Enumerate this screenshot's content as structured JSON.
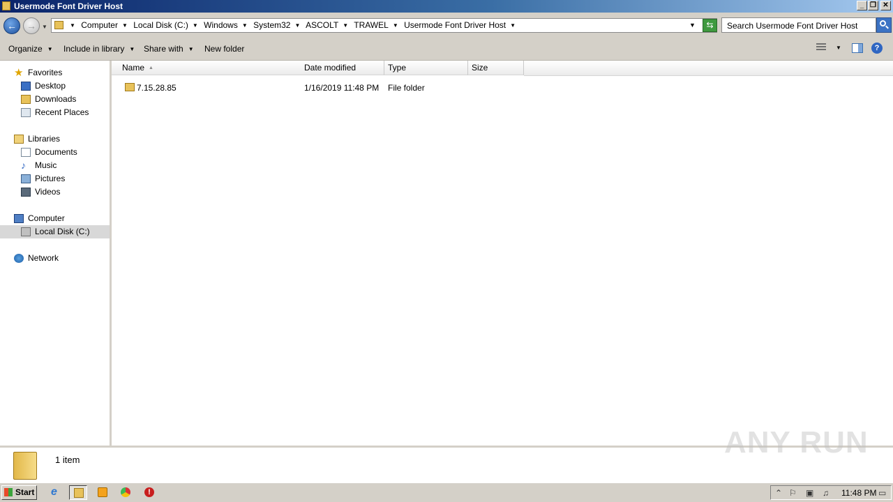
{
  "window": {
    "title": "Usermode Font Driver Host",
    "buttons": {
      "minimize": "_",
      "restore": "❐",
      "close": "✕"
    }
  },
  "address_bar": {
    "breadcrumbs": [
      "Computer",
      "Local Disk (C:)",
      "Windows",
      "System32",
      "ASCOLT",
      "TRAWEL",
      "Usermode Font Driver Host"
    ],
    "search_placeholder": "Search Usermode Font Driver Host"
  },
  "toolbar": {
    "organize": "Organize",
    "include_in_library": "Include in library",
    "share_with": "Share with",
    "new_folder": "New folder",
    "help": "?"
  },
  "nav": {
    "favorites": {
      "label": "Favorites",
      "items": [
        "Desktop",
        "Downloads",
        "Recent Places"
      ]
    },
    "libraries": {
      "label": "Libraries",
      "items": [
        "Documents",
        "Music",
        "Pictures",
        "Videos"
      ]
    },
    "computer": {
      "label": "Computer",
      "items": [
        "Local Disk (C:)"
      ]
    },
    "network": {
      "label": "Network"
    }
  },
  "columns": {
    "name": "Name",
    "date_modified": "Date modified",
    "type": "Type",
    "size": "Size"
  },
  "files": [
    {
      "name": "7.15.28.85",
      "date_modified": "1/16/2019 11:48 PM",
      "type": "File folder",
      "size": ""
    }
  ],
  "status": {
    "item_count": "1 item"
  },
  "watermark": "ANY RUN",
  "taskbar": {
    "start": "Start",
    "time": "11:48 PM"
  },
  "colors": {
    "title_gradient_start": "#0a246a",
    "title_gradient_end": "#a6caf0",
    "selection": "#d8d8d8",
    "chrome": "#d4d0c8"
  }
}
